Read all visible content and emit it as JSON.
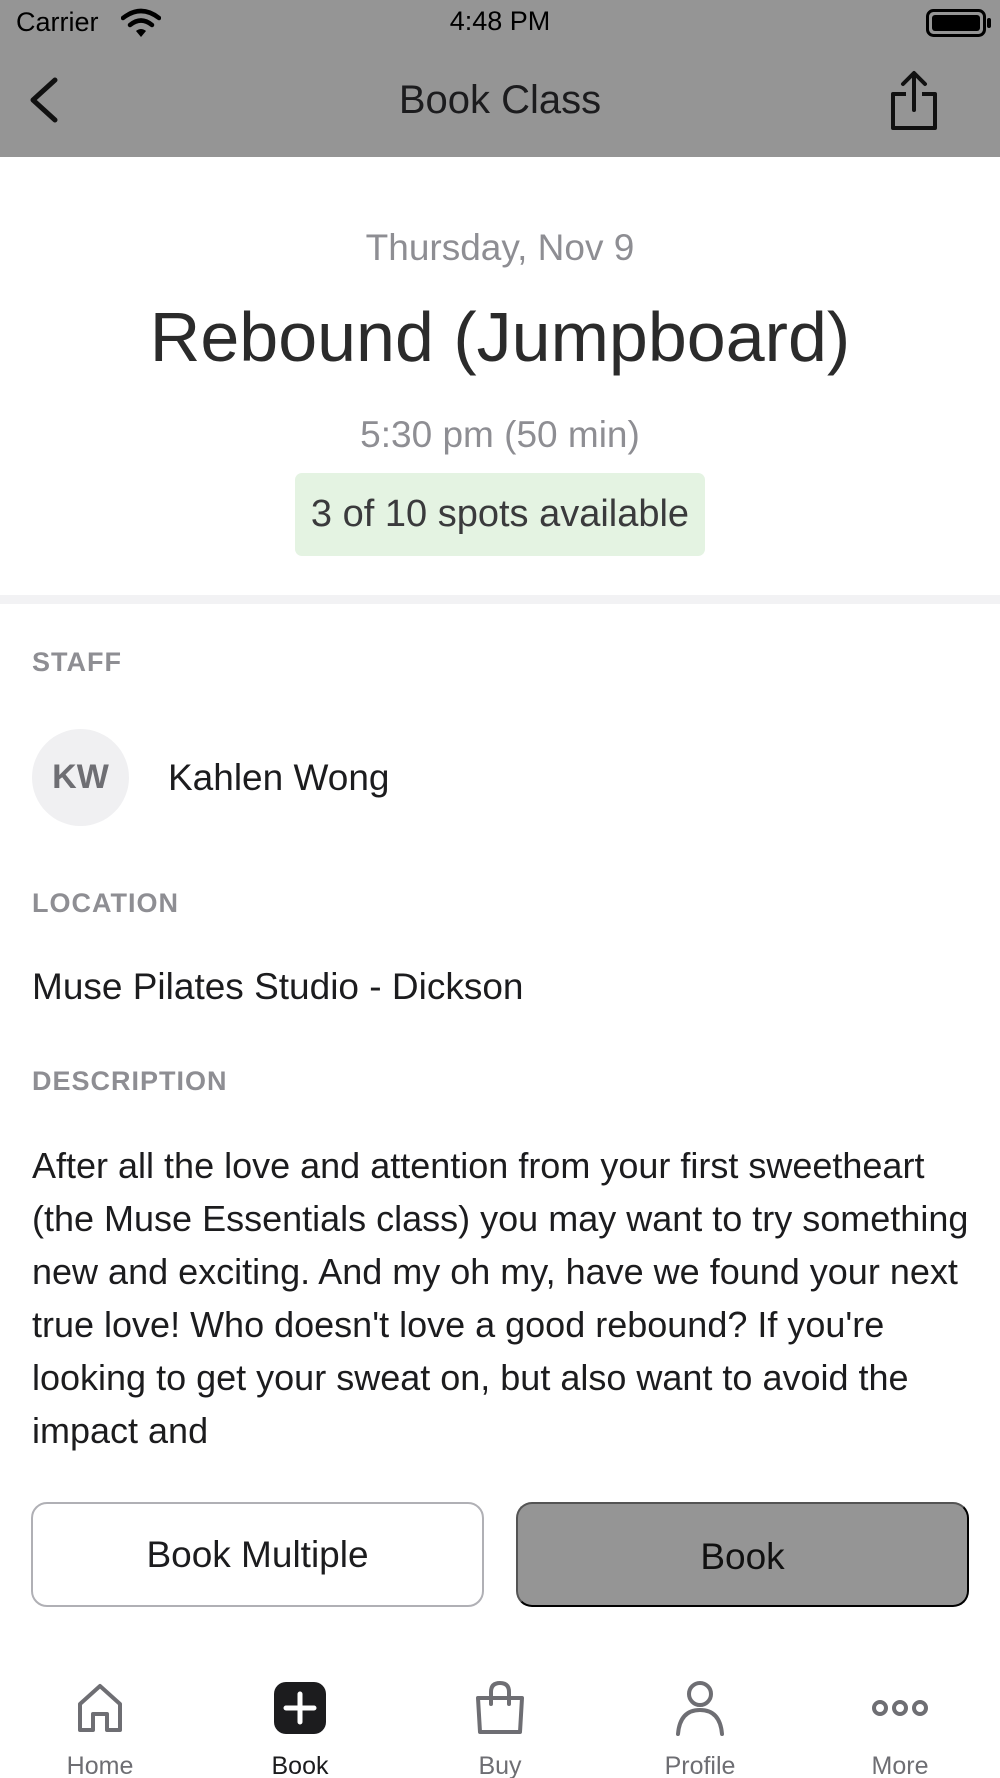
{
  "status_bar": {
    "carrier": "Carrier",
    "time": "4:48 PM"
  },
  "nav": {
    "title": "Book Class",
    "icons": [
      "back-icon",
      "share-icon"
    ]
  },
  "class_info": {
    "date": "Thursday, Nov 9",
    "title": "Rebound (Jumpboard)",
    "time": "5:30 pm (50 min)",
    "spots": "3 of 10 spots available"
  },
  "staff": {
    "label": "STAFF",
    "initials": "KW",
    "name": "Kahlen Wong"
  },
  "location": {
    "label": "LOCATION",
    "value": "Muse Pilates Studio - Dickson"
  },
  "description": {
    "label": "DESCRIPTION",
    "text": "After all the love and attention from your first sweetheart (the Muse Essentials class) you may want to try something new and exciting. And my oh my, have we found your next true love! Who doesn't love a good rebound? If you're looking to get your sweat on, but also want to avoid the impact and"
  },
  "actions": {
    "book_multiple": "Book Multiple",
    "book": "Book"
  },
  "tabbar": {
    "items": [
      {
        "label": "Home",
        "icon": "home-icon"
      },
      {
        "label": "Book",
        "icon": "plus-square-icon",
        "active": true
      },
      {
        "label": "Buy",
        "icon": "shopping-bag-icon"
      },
      {
        "label": "Profile",
        "icon": "person-icon"
      },
      {
        "label": "More",
        "icon": "more-dots-icon"
      }
    ]
  },
  "colors": {
    "header_bg": "#959595",
    "spots_bg": "#e4f3e2",
    "book_button_bg": "#959595"
  }
}
